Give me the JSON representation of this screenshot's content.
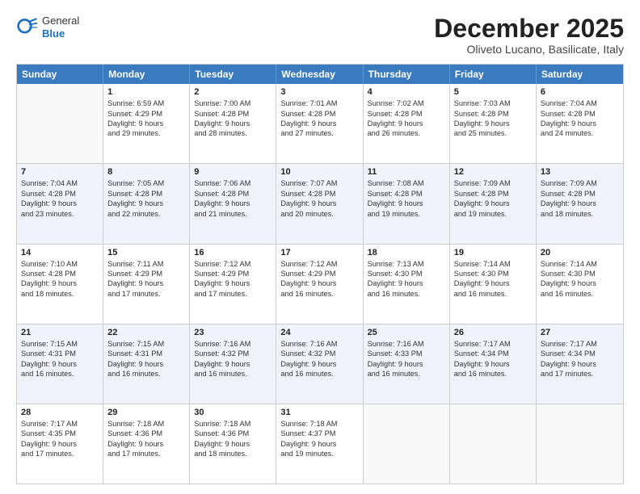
{
  "header": {
    "logo_general": "General",
    "logo_blue": "Blue",
    "month": "December 2025",
    "location": "Oliveto Lucano, Basilicate, Italy"
  },
  "days_of_week": [
    "Sunday",
    "Monday",
    "Tuesday",
    "Wednesday",
    "Thursday",
    "Friday",
    "Saturday"
  ],
  "weeks": [
    [
      {
        "day": "",
        "sunrise": "",
        "sunset": "",
        "daylight": ""
      },
      {
        "day": "1",
        "sunrise": "Sunrise: 6:59 AM",
        "sunset": "Sunset: 4:29 PM",
        "daylight": "Daylight: 9 hours and 29 minutes."
      },
      {
        "day": "2",
        "sunrise": "Sunrise: 7:00 AM",
        "sunset": "Sunset: 4:28 PM",
        "daylight": "Daylight: 9 hours and 28 minutes."
      },
      {
        "day": "3",
        "sunrise": "Sunrise: 7:01 AM",
        "sunset": "Sunset: 4:28 PM",
        "daylight": "Daylight: 9 hours and 27 minutes."
      },
      {
        "day": "4",
        "sunrise": "Sunrise: 7:02 AM",
        "sunset": "Sunset: 4:28 PM",
        "daylight": "Daylight: 9 hours and 26 minutes."
      },
      {
        "day": "5",
        "sunrise": "Sunrise: 7:03 AM",
        "sunset": "Sunset: 4:28 PM",
        "daylight": "Daylight: 9 hours and 25 minutes."
      },
      {
        "day": "6",
        "sunrise": "Sunrise: 7:04 AM",
        "sunset": "Sunset: 4:28 PM",
        "daylight": "Daylight: 9 hours and 24 minutes."
      }
    ],
    [
      {
        "day": "7",
        "sunrise": "Sunrise: 7:04 AM",
        "sunset": "Sunset: 4:28 PM",
        "daylight": "Daylight: 9 hours and 23 minutes."
      },
      {
        "day": "8",
        "sunrise": "Sunrise: 7:05 AM",
        "sunset": "Sunset: 4:28 PM",
        "daylight": "Daylight: 9 hours and 22 minutes."
      },
      {
        "day": "9",
        "sunrise": "Sunrise: 7:06 AM",
        "sunset": "Sunset: 4:28 PM",
        "daylight": "Daylight: 9 hours and 21 minutes."
      },
      {
        "day": "10",
        "sunrise": "Sunrise: 7:07 AM",
        "sunset": "Sunset: 4:28 PM",
        "daylight": "Daylight: 9 hours and 20 minutes."
      },
      {
        "day": "11",
        "sunrise": "Sunrise: 7:08 AM",
        "sunset": "Sunset: 4:28 PM",
        "daylight": "Daylight: 9 hours and 19 minutes."
      },
      {
        "day": "12",
        "sunrise": "Sunrise: 7:09 AM",
        "sunset": "Sunset: 4:28 PM",
        "daylight": "Daylight: 9 hours and 19 minutes."
      },
      {
        "day": "13",
        "sunrise": "Sunrise: 7:09 AM",
        "sunset": "Sunset: 4:28 PM",
        "daylight": "Daylight: 9 hours and 18 minutes."
      }
    ],
    [
      {
        "day": "14",
        "sunrise": "Sunrise: 7:10 AM",
        "sunset": "Sunset: 4:28 PM",
        "daylight": "Daylight: 9 hours and 18 minutes."
      },
      {
        "day": "15",
        "sunrise": "Sunrise: 7:11 AM",
        "sunset": "Sunset: 4:29 PM",
        "daylight": "Daylight: 9 hours and 17 minutes."
      },
      {
        "day": "16",
        "sunrise": "Sunrise: 7:12 AM",
        "sunset": "Sunset: 4:29 PM",
        "daylight": "Daylight: 9 hours and 17 minutes."
      },
      {
        "day": "17",
        "sunrise": "Sunrise: 7:12 AM",
        "sunset": "Sunset: 4:29 PM",
        "daylight": "Daylight: 9 hours and 16 minutes."
      },
      {
        "day": "18",
        "sunrise": "Sunrise: 7:13 AM",
        "sunset": "Sunset: 4:30 PM",
        "daylight": "Daylight: 9 hours and 16 minutes."
      },
      {
        "day": "19",
        "sunrise": "Sunrise: 7:14 AM",
        "sunset": "Sunset: 4:30 PM",
        "daylight": "Daylight: 9 hours and 16 minutes."
      },
      {
        "day": "20",
        "sunrise": "Sunrise: 7:14 AM",
        "sunset": "Sunset: 4:30 PM",
        "daylight": "Daylight: 9 hours and 16 minutes."
      }
    ],
    [
      {
        "day": "21",
        "sunrise": "Sunrise: 7:15 AM",
        "sunset": "Sunset: 4:31 PM",
        "daylight": "Daylight: 9 hours and 16 minutes."
      },
      {
        "day": "22",
        "sunrise": "Sunrise: 7:15 AM",
        "sunset": "Sunset: 4:31 PM",
        "daylight": "Daylight: 9 hours and 16 minutes."
      },
      {
        "day": "23",
        "sunrise": "Sunrise: 7:16 AM",
        "sunset": "Sunset: 4:32 PM",
        "daylight": "Daylight: 9 hours and 16 minutes."
      },
      {
        "day": "24",
        "sunrise": "Sunrise: 7:16 AM",
        "sunset": "Sunset: 4:32 PM",
        "daylight": "Daylight: 9 hours and 16 minutes."
      },
      {
        "day": "25",
        "sunrise": "Sunrise: 7:16 AM",
        "sunset": "Sunset: 4:33 PM",
        "daylight": "Daylight: 9 hours and 16 minutes."
      },
      {
        "day": "26",
        "sunrise": "Sunrise: 7:17 AM",
        "sunset": "Sunset: 4:34 PM",
        "daylight": "Daylight: 9 hours and 16 minutes."
      },
      {
        "day": "27",
        "sunrise": "Sunrise: 7:17 AM",
        "sunset": "Sunset: 4:34 PM",
        "daylight": "Daylight: 9 hours and 17 minutes."
      }
    ],
    [
      {
        "day": "28",
        "sunrise": "Sunrise: 7:17 AM",
        "sunset": "Sunset: 4:35 PM",
        "daylight": "Daylight: 9 hours and 17 minutes."
      },
      {
        "day": "29",
        "sunrise": "Sunrise: 7:18 AM",
        "sunset": "Sunset: 4:36 PM",
        "daylight": "Daylight: 9 hours and 17 minutes."
      },
      {
        "day": "30",
        "sunrise": "Sunrise: 7:18 AM",
        "sunset": "Sunset: 4:36 PM",
        "daylight": "Daylight: 9 hours and 18 minutes."
      },
      {
        "day": "31",
        "sunrise": "Sunrise: 7:18 AM",
        "sunset": "Sunset: 4:37 PM",
        "daylight": "Daylight: 9 hours and 19 minutes."
      },
      {
        "day": "",
        "sunrise": "",
        "sunset": "",
        "daylight": ""
      },
      {
        "day": "",
        "sunrise": "",
        "sunset": "",
        "daylight": ""
      },
      {
        "day": "",
        "sunrise": "",
        "sunset": "",
        "daylight": ""
      }
    ]
  ]
}
